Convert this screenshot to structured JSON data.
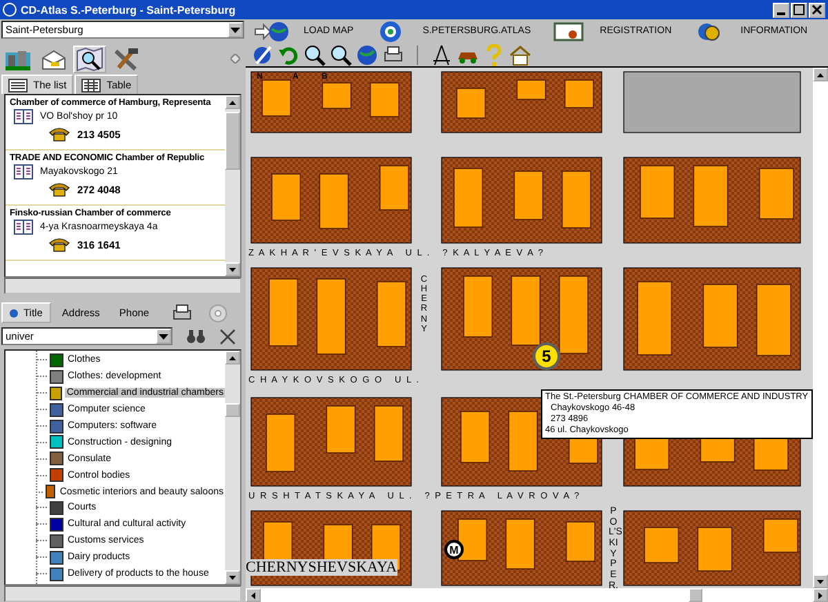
{
  "window": {
    "title": "CD-Atlas S.-Peterburg - Saint-Petersburg"
  },
  "city_select": {
    "value": "Saint-Petersburg"
  },
  "mode_tabs": [
    {
      "selected": false
    },
    {
      "selected": false
    },
    {
      "selected": true
    },
    {
      "selected": false
    }
  ],
  "list_tabs": [
    {
      "label": "The list",
      "selected": true
    },
    {
      "label": "Table",
      "selected": false
    }
  ],
  "results": [
    {
      "name": "Chamber of commerce of Hamburg, Representa",
      "address": "VO Bol'shoy pr 10",
      "phone": "213 4505"
    },
    {
      "name": "TRADE AND ECONOMIC Chamber of Republic",
      "address": "Mayakovskogo 21",
      "phone": "272 4048"
    },
    {
      "name": "Finsko-russian Chamber of commerce",
      "address": "4-ya Krasnoarmeyskaya 4a",
      "phone": "316 1641"
    }
  ],
  "search_tabs": [
    {
      "label": "Title",
      "selected": true
    },
    {
      "label": "Address",
      "selected": false
    },
    {
      "label": "Phone",
      "selected": false
    }
  ],
  "search_field": {
    "value": "univer"
  },
  "categories": [
    {
      "label": "Clothes",
      "selected": false
    },
    {
      "label": "Clothes: development",
      "selected": false
    },
    {
      "label": "Commercial and industrial chambers",
      "selected": true
    },
    {
      "label": "Computer science",
      "selected": false
    },
    {
      "label": "Computers: software",
      "selected": false
    },
    {
      "label": "Construction - designing",
      "selected": false
    },
    {
      "label": "Consulate",
      "selected": false
    },
    {
      "label": "Control bodies",
      "selected": false
    },
    {
      "label": "Cosmetic interiors and beauty saloons",
      "selected": false
    },
    {
      "label": "Courts",
      "selected": false
    },
    {
      "label": "Cultural and cultural activity",
      "selected": false
    },
    {
      "label": "Customs services",
      "selected": false
    },
    {
      "label": "Dairy products",
      "selected": false
    },
    {
      "label": "Delivery of products to the house",
      "selected": false
    }
  ],
  "toolbar": [
    {
      "label": "LOAD MAP"
    },
    {
      "label": "S.PETERSBURG.ATLAS"
    },
    {
      "label": "REGISTRATION"
    },
    {
      "label": "INFORMATION"
    }
  ],
  "map": {
    "ruler_labels": [
      "N",
      "A",
      "B"
    ],
    "streets": [
      {
        "label": "Z A K H A R ' E V S K A Y A   U L .   ? K A L Y A E V A ?",
        "kind": "horizontal"
      },
      {
        "label": "C H A Y K O V S K O G O   U L .",
        "kind": "horizontal"
      },
      {
        "label": "U R S H T A T S K A Y A   U L .   ? P E T R A   L A V R O V A ?",
        "kind": "horizontal"
      },
      {
        "label": "CHERNYSHEVSKAYA",
        "kind": "area"
      },
      {
        "label": "POL'SKIY PER.",
        "kind": "vertical"
      },
      {
        "label": "C H E R N Y",
        "kind": "vertical"
      }
    ],
    "marker_label": "5",
    "metro_label": "M",
    "tooltip": [
      "The St.-Petersburg CHAMBER OF COMMERCE AND INDUSTRY",
      "Chaykovskogo 46-48",
      "273 4896",
      "46 ul. Chaykovskogo"
    ]
  }
}
